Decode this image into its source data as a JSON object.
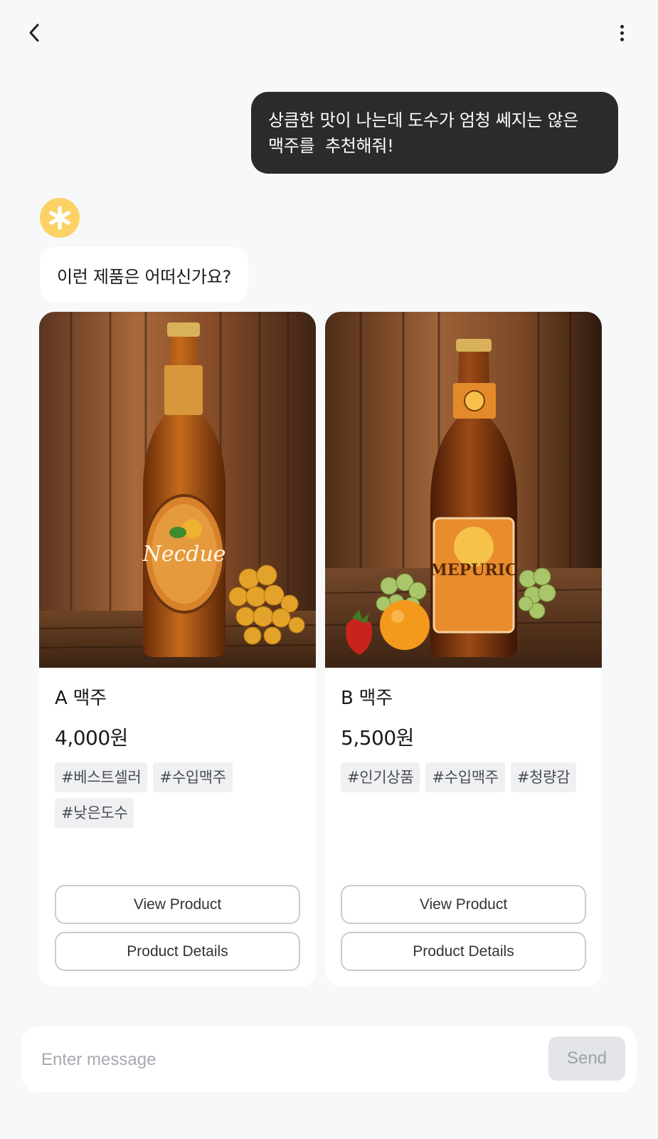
{
  "header": {
    "back_icon": "chevron-left-icon",
    "more_icon": "more-vertical-icon"
  },
  "chat": {
    "user_message_line1": "상큼한 맛이 나는데 도수가 엄청 쎄지는 않은",
    "user_message_line2": "맥주를  추천해줘!",
    "bot_avatar_icon": "asterisk-icon",
    "bot_message": "이런 제품은 어떠신가요?"
  },
  "products": [
    {
      "name": "A 맥주",
      "price": "4,000원",
      "tags": [
        "#베스트셀러",
        "#수입맥주",
        "#낮은도수"
      ],
      "view_label": "View Product",
      "details_label": "Product Details",
      "image_label": "Necdue"
    },
    {
      "name": "B 맥주",
      "price": "5,500원",
      "tags": [
        "#인기상품",
        "#수입맥주",
        "#청량감"
      ],
      "view_label": "View Product",
      "details_label": "Product Details",
      "image_label": "MEPURIC"
    }
  ],
  "composer": {
    "placeholder": "Enter message",
    "send_label": "Send"
  },
  "colors": {
    "background": "#f6f8fa",
    "user_bubble": "#2a2b2c",
    "avatar": "#fcd265",
    "send_disabled": "#e3e5e8"
  }
}
